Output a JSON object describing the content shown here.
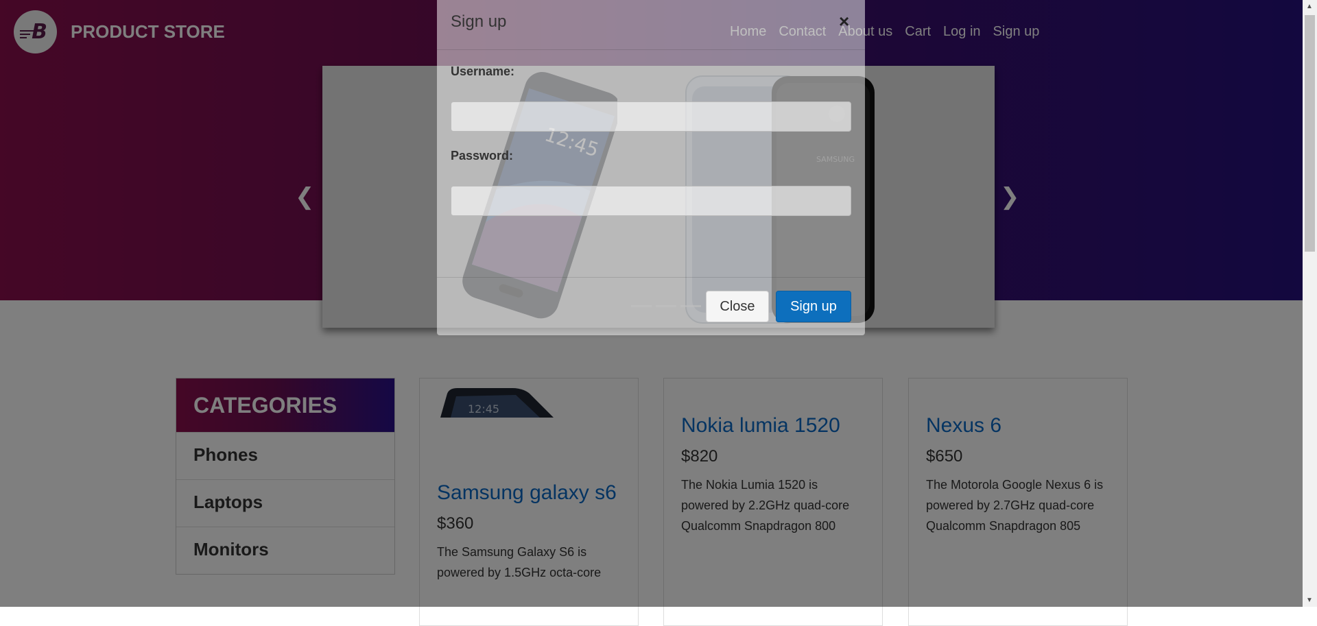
{
  "brand": {
    "name": "PRODUCT STORE",
    "logo_letter": "B"
  },
  "nav": {
    "items": [
      {
        "label": "Home"
      },
      {
        "label": "Contact"
      },
      {
        "label": "About us"
      },
      {
        "label": "Cart"
      },
      {
        "label": "Log in"
      },
      {
        "label": "Sign up"
      }
    ]
  },
  "carousel": {
    "prev_icon": "chevron-left-icon",
    "next_icon": "chevron-right-icon",
    "phone1_time": "12:45",
    "phone_brand": "SAMSUNG"
  },
  "categories": {
    "header": "CATEGORIES",
    "items": [
      {
        "label": "Phones"
      },
      {
        "label": "Laptops"
      },
      {
        "label": "Monitors"
      }
    ]
  },
  "products": [
    {
      "title": "Samsung galaxy s6",
      "price": "$360",
      "desc": "The Samsung Galaxy S6 is powered by 1.5GHz octa-core",
      "img_time": "12:45"
    },
    {
      "title": "Nokia lumia 1520",
      "price": "$820",
      "desc": "The Nokia Lumia 1520 is powered by 2.2GHz quad-core Qualcomm Snapdragon 800"
    },
    {
      "title": "Nexus 6",
      "price": "$650",
      "desc": "The Motorola Google Nexus 6 is powered by 2.7GHz quad-core Qualcomm Snapdragon 805"
    }
  ],
  "modal": {
    "title": "Sign up",
    "close_symbol": "×",
    "username_label": "Username:",
    "username_value": "",
    "password_label": "Password:",
    "password_value": "",
    "close_button": "Close",
    "signup_button": "Sign up"
  },
  "colors": {
    "hero_start": "#8a0e4d",
    "hero_end": "#26107e",
    "link_blue": "#0a68c4",
    "primary_button": "#0d6fbd"
  }
}
